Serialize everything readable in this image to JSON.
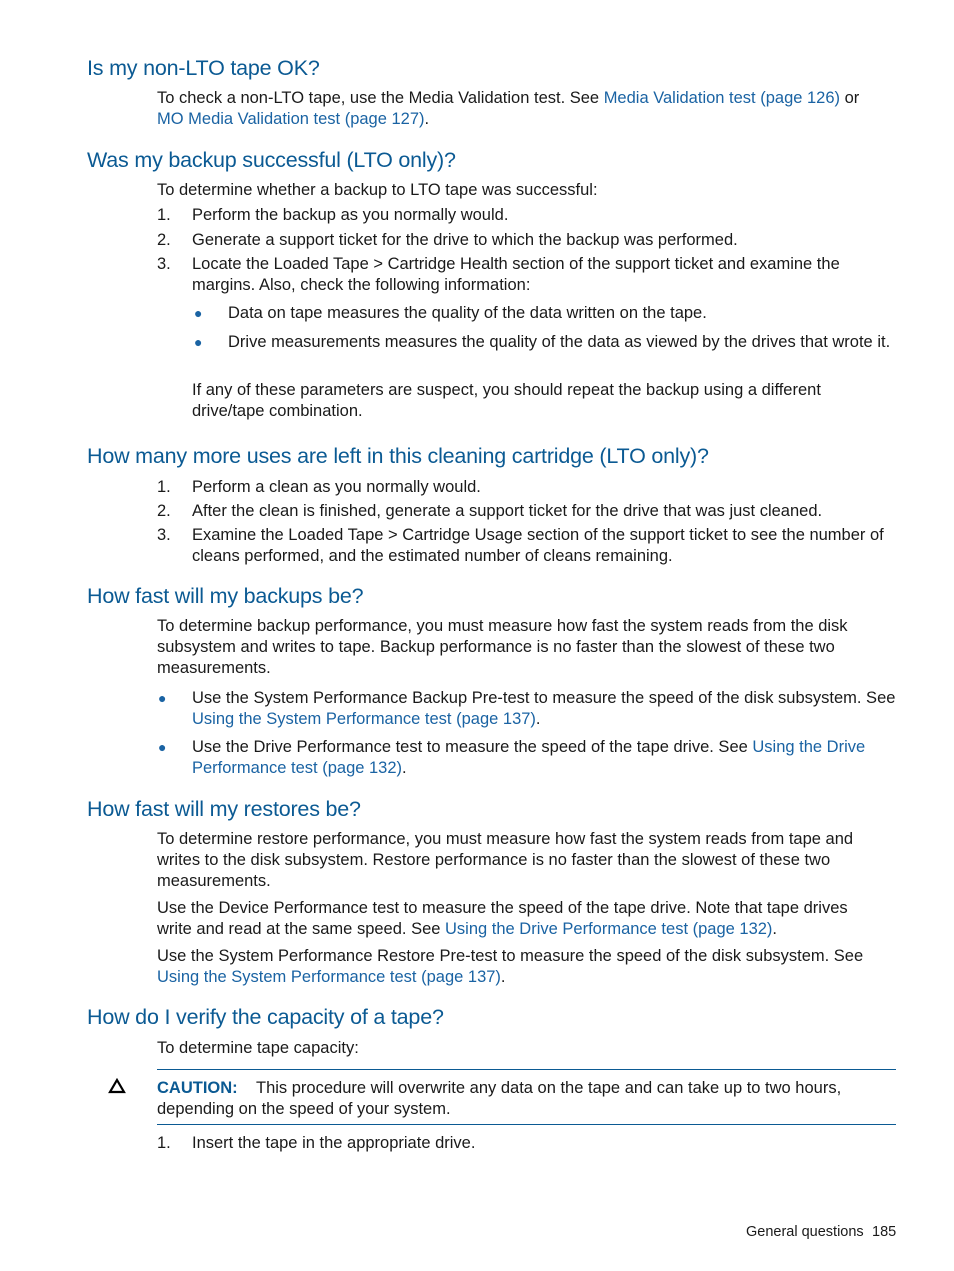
{
  "sections": [
    {
      "heading": "Is my non-LTO tape OK?",
      "intro": "To check a non-LTO tape, use the Media Validation test. See ",
      "link1": "Media Validation test (page 126)",
      "mid": " or",
      "link2": "MO Media Validation test (page 127)",
      "end": "."
    },
    {
      "heading": "Was my backup successful (LTO only)?",
      "intro": "To determine whether a backup to LTO tape was successful:",
      "steps": [
        {
          "n": "1.",
          "text": "Perform the backup as you normally would."
        },
        {
          "n": "2.",
          "text": "Generate a support ticket for the drive to which the backup was performed."
        },
        {
          "n": "3.",
          "text": "Locate the Loaded Tape > Cartridge Health section of the support ticket and examine the margins. Also, check the following information:"
        }
      ],
      "bullets": [
        "Data on tape measures the quality of the data written on the tape.",
        "Drive measurements measures the quality of the data as viewed by the drives that wrote it."
      ],
      "outro": "If any of these parameters are suspect, you should repeat the backup using a different drive/tape combination."
    },
    {
      "heading": "How many more uses are left in this cleaning cartridge (LTO only)?",
      "steps": [
        {
          "n": "1.",
          "text": "Perform a clean as you normally would."
        },
        {
          "n": "2.",
          "text": "After the clean is finished, generate a support ticket for the drive that was just cleaned."
        },
        {
          "n": "3.",
          "text": "Examine the Loaded Tape > Cartridge Usage section of the support ticket to see the number of cleans performed, and the estimated number of cleans remaining."
        }
      ]
    },
    {
      "heading": "How fast will my backups be?",
      "intro": "To determine backup performance, you must measure how fast the system reads from the disk subsystem and writes to tape. Backup performance is no faster than the slowest of these two measurements.",
      "bullets": [
        {
          "text": "Use the System Performance Backup Pre-test to measure the speed of the disk subsystem. See ",
          "link": "Using the System Performance test (page 137)",
          "end": "."
        },
        {
          "text": "Use the Drive Performance test to measure the speed of the tape drive. See ",
          "link": "Using the Drive Performance test (page 132)",
          "end": "."
        }
      ]
    },
    {
      "heading": "How fast will my restores be?",
      "intro": "To determine restore performance, you must measure how fast the system reads from tape and writes to the disk subsystem. Restore performance is no faster than the slowest of these two measurements.",
      "para2": {
        "text": "Use the Device Performance test to measure the speed of the tape drive. Note that tape drives write and read at the same speed. See ",
        "link": "Using the Drive Performance test (page 132)",
        "end": "."
      },
      "para3": {
        "text": "Use the System Performance Restore Pre-test to measure the speed of the disk subsystem. See ",
        "link": "Using the System Performance test (page 137)",
        "end": "."
      }
    },
    {
      "heading": "How do I verify the capacity of a tape?",
      "intro": "To determine tape capacity:",
      "caution_label": "CAUTION:",
      "caution_text": "This procedure will overwrite any data on the tape and can take up to two hours, depending on the speed of your system.",
      "steps": [
        {
          "n": "1.",
          "text": "Insert the tape in the appropriate drive."
        }
      ]
    }
  ],
  "footer": {
    "section": "General questions",
    "page": "185"
  },
  "colors": {
    "heading": "#0b5a93",
    "link": "#1a63a3",
    "text": "#1a1a1a"
  }
}
